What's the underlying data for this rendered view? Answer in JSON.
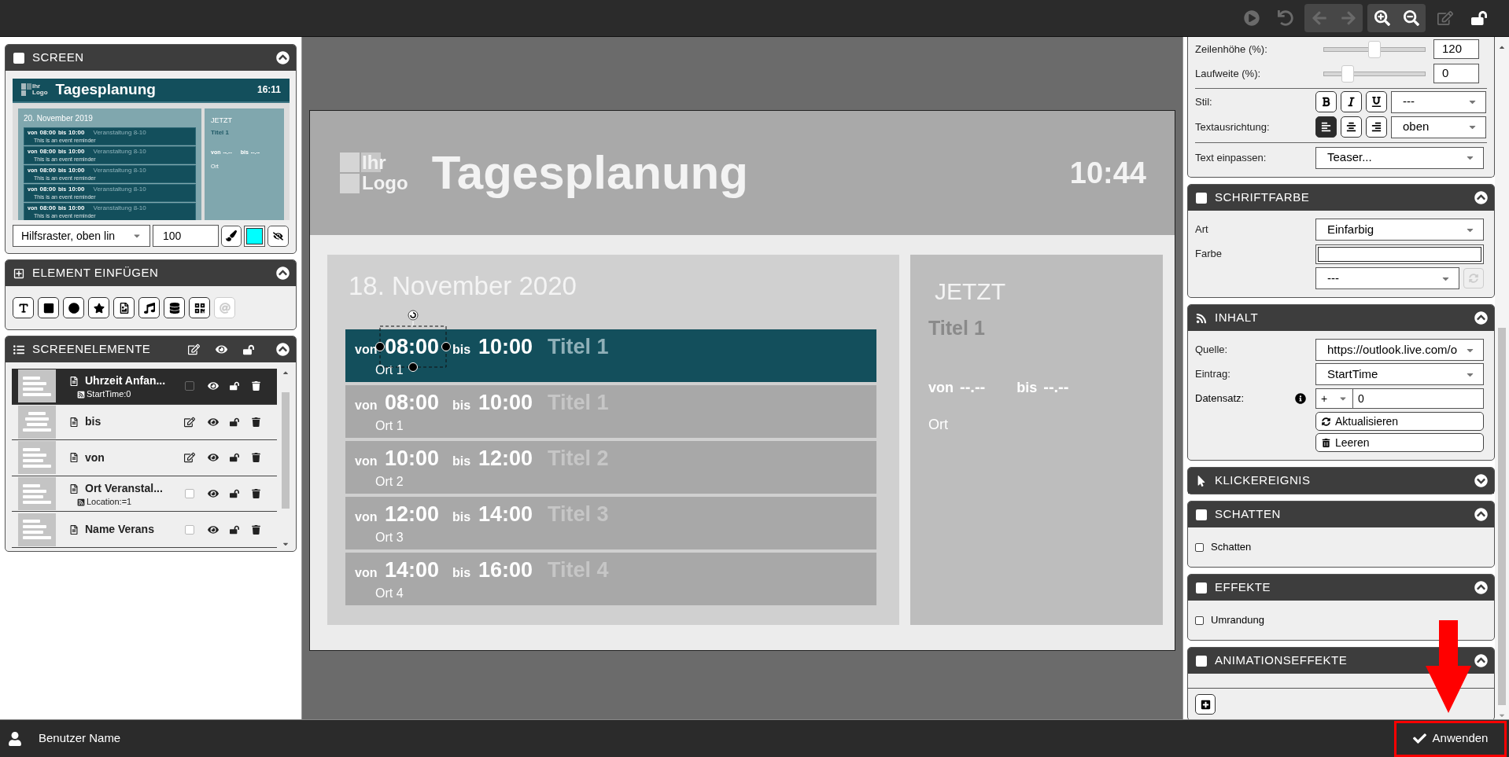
{
  "toolbar": [
    {
      "buttons": [
        {
          "kind": "play",
          "disabled": true
        }
      ]
    },
    {
      "buttons": [
        {
          "kind": "undo",
          "disabled": true
        }
      ]
    },
    {
      "buttons": [
        {
          "kind": "back",
          "disabled": true
        },
        {
          "kind": "forward",
          "disabled": true
        }
      ]
    },
    {
      "buttons": [
        {
          "kind": "zoom_in",
          "disabled": false
        },
        {
          "kind": "zoom_out",
          "disabled": false
        }
      ]
    },
    {
      "buttons": [
        {
          "kind": "edit",
          "disabled": true
        }
      ]
    },
    {
      "buttons": [
        {
          "kind": "lock",
          "disabled": false
        }
      ]
    }
  ],
  "screen_panel": {
    "title": "SCREEN",
    "kind": "square",
    "expanded": true,
    "preview": {
      "logo_top": "Ihr",
      "logo_bottom": "Logo",
      "title": "Tagesplanung",
      "time": "16:11",
      "date": "20. November 2019",
      "events": [
        {
          "from_label": "von",
          "start": "08:00",
          "to_label": "bis",
          "end": "10:00",
          "title": "Veranstaltung 8-10",
          "note": "This is an event reminder"
        },
        {
          "from_label": "von",
          "start": "08:00",
          "to_label": "bis",
          "end": "10:00",
          "title": "Veranstaltung 8-10",
          "note": "This is an event reminder"
        },
        {
          "from_label": "von",
          "start": "08:00",
          "to_label": "bis",
          "end": "10:00",
          "title": "Veranstaltung 8-10",
          "note": "This is an event reminder"
        },
        {
          "from_label": "von",
          "start": "08:00",
          "to_label": "bis",
          "end": "10:00",
          "title": "Veranstaltung 8-10",
          "note": "This is an event reminder"
        },
        {
          "from_label": "von",
          "start": "08:00",
          "to_label": "bis",
          "end": "10:00",
          "title": "Veranstaltung 8-10",
          "note": "This is an event reminder"
        }
      ],
      "now": {
        "heading": "JETZT",
        "title": "Titel 1",
        "from_label": "von",
        "start": "--.--",
        "to_label": "bis",
        "end": "--.--",
        "location": "Ort"
      }
    },
    "grid_select": "Hilfsraster, oben lin",
    "grid_size": "100",
    "grid_swatch": {
      "color": "#00ffff"
    }
  },
  "insert_panel": {
    "title": "ELEMENT EINFÜGEN",
    "kind": "plus",
    "expanded": true,
    "tools": [
      {
        "kind": "text",
        "disabled": false
      },
      {
        "kind": "rectangle",
        "disabled": false
      },
      {
        "kind": "circle",
        "disabled": false
      },
      {
        "kind": "star",
        "disabled": false
      },
      {
        "kind": "image",
        "disabled": false
      },
      {
        "kind": "audio",
        "disabled": false
      },
      {
        "kind": "data",
        "disabled": false
      },
      {
        "kind": "qr",
        "disabled": false
      },
      {
        "kind": "email",
        "disabled": true
      }
    ]
  },
  "elements_panel": {
    "title": "SCREENELEMENTE",
    "kind": "list",
    "expanded": true,
    "items": [
      {
        "name": "Uhrzeit Anfan...",
        "source": "StartTime:0",
        "kind": "bound",
        "checked": false,
        "centered": false,
        "selected": true
      },
      {
        "name": "bis",
        "kind": "plain",
        "centered": true,
        "selected": false
      },
      {
        "name": "von",
        "kind": "plain",
        "centered": false,
        "selected": false
      },
      {
        "name": "Ort Veranstal...",
        "source": "Location:=1",
        "kind": "bound",
        "checked": false,
        "centered": false,
        "selected": false
      },
      {
        "name": "Name Verans",
        "kind": "bound",
        "checked": false,
        "centered": false,
        "selected": false
      }
    ]
  },
  "canvas": {
    "logo_top": "Ihr",
    "logo_bottom": "Logo",
    "title": "Tagesplanung",
    "time": "10:44",
    "date": "18. November 2020",
    "events": [
      {
        "from_label": "von",
        "start": "08:00",
        "to_label": "bis",
        "end": "10:00",
        "title": "Titel 1",
        "location": "Ort 1",
        "selected": true
      },
      {
        "from_label": "von",
        "start": "08:00",
        "to_label": "bis",
        "end": "10:00",
        "title": "Titel 1",
        "location": "Ort 1",
        "selected": false
      },
      {
        "from_label": "von",
        "start": "10:00",
        "to_label": "bis",
        "end": "12:00",
        "title": "Titel 2",
        "location": "Ort 2",
        "selected": false
      },
      {
        "from_label": "von",
        "start": "12:00",
        "to_label": "bis",
        "end": "14:00",
        "title": "Titel 3",
        "location": "Ort 3",
        "selected": false
      },
      {
        "from_label": "von",
        "start": "14:00",
        "to_label": "bis",
        "end": "16:00",
        "title": "Titel 4",
        "location": "Ort 4",
        "selected": false
      }
    ],
    "now": {
      "heading": "JETZT",
      "title": "Titel 1",
      "from_label": "von",
      "start": "--.--",
      "to_label": "bis",
      "end": "--.--",
      "location": "Ort"
    }
  },
  "text_settings": {
    "sliders": [
      {
        "label": "Zeilenhöhe (%):",
        "level": 0.5,
        "value": "120"
      },
      {
        "label": "Laufweite (%):",
        "level": 0.2,
        "value": "0"
      }
    ],
    "style_label": "Stil:",
    "styles": [
      {
        "kind": "bold",
        "selected": false
      },
      {
        "kind": "italic",
        "selected": false
      },
      {
        "kind": "underline",
        "selected": false
      }
    ],
    "style_select": "---",
    "align_label": "Textausrichtung:",
    "aligns": [
      {
        "kind": "left",
        "selected": true
      },
      {
        "kind": "center",
        "selected": false
      },
      {
        "kind": "right",
        "selected": false
      }
    ],
    "align_select": "oben",
    "fit_label": "Text einpassen:",
    "fit_select": "Teaser..."
  },
  "font_color": {
    "title": "SCHRIFTFARBE",
    "kind": "square",
    "expanded": true,
    "type_label": "Art",
    "type": "Einfarbig",
    "color_label": "Farbe",
    "color_field": {
      "color": "#ffffff"
    },
    "preset": "---",
    "refresh_disabled": true
  },
  "content": {
    "title": "INHALT",
    "kind": "rss",
    "expanded": true,
    "source_label": "Quelle:",
    "source": "https://outlook.live.com/o",
    "entry_label": "Eintrag:",
    "entry": "StartTime",
    "record_label": "Datensatz:",
    "record_sign": "+",
    "record": "0",
    "buttons": [
      {
        "kind": "refresh",
        "label": "Aktualisieren"
      },
      {
        "kind": "clear",
        "label": "Leeren"
      }
    ]
  },
  "click_event": {
    "title": "KLICKEREIGNIS",
    "kind": "pointer",
    "expanded": false
  },
  "shadow": {
    "title": "SCHATTEN",
    "kind": "square",
    "expanded": true,
    "option": {
      "label": "Schatten",
      "checked": false
    }
  },
  "effects": {
    "title": "EFFEKTE",
    "kind": "square",
    "expanded": true,
    "option": {
      "label": "Umrandung",
      "checked": false
    }
  },
  "animation": {
    "title": "ANIMATIONSEFFEKTE",
    "kind": "square",
    "expanded": true
  },
  "status_bar": {
    "user": "Benutzer Name",
    "apply": "Anwenden"
  }
}
